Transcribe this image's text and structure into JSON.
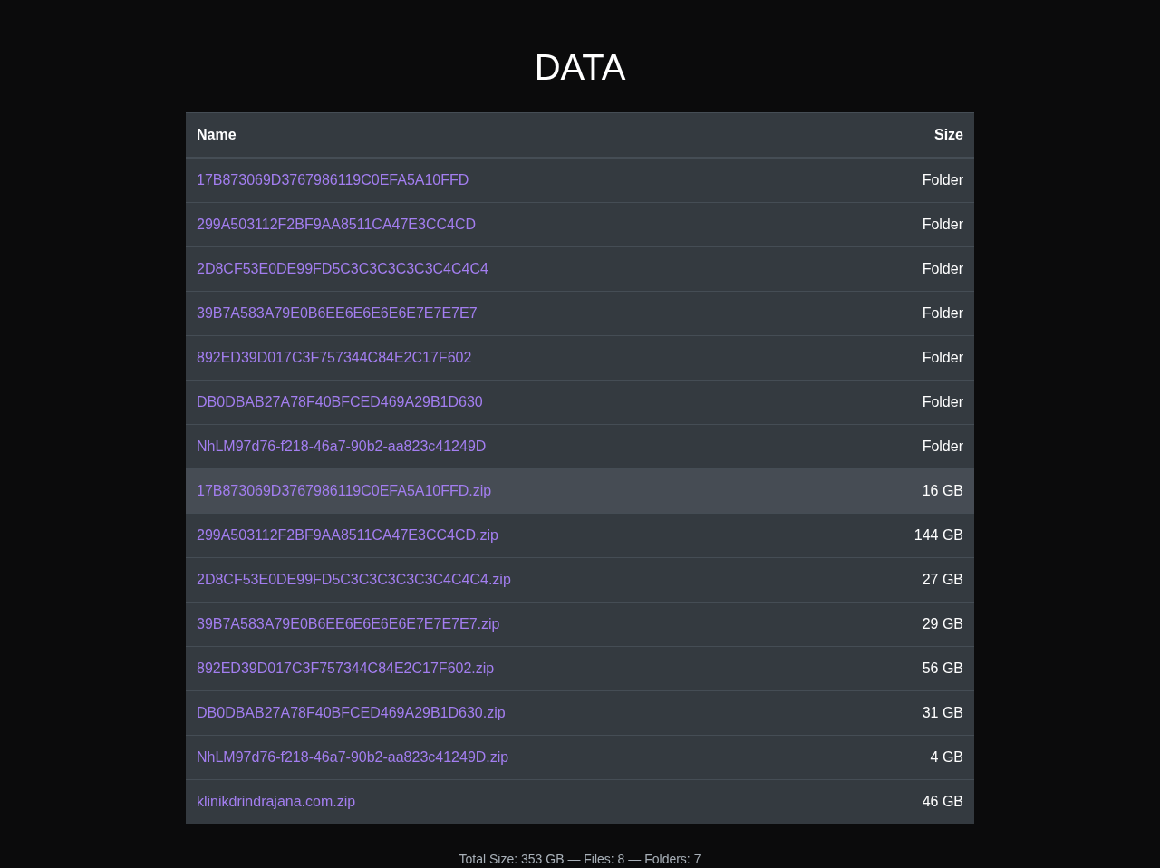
{
  "title": "DATA",
  "table": {
    "columns": [
      "Name",
      "Size"
    ],
    "rows": [
      {
        "name": "17B873069D3767986119C0EFA5A10FFD",
        "size": "Folder",
        "highlighted": false
      },
      {
        "name": "299A503112F2BF9AA8511CA47E3CC4CD",
        "size": "Folder",
        "highlighted": false
      },
      {
        "name": "2D8CF53E0DE99FD5C3C3C3C3C3C4C4C4",
        "size": "Folder",
        "highlighted": false
      },
      {
        "name": "39B7A583A79E0B6EE6E6E6E6E7E7E7E7",
        "size": "Folder",
        "highlighted": false
      },
      {
        "name": "892ED39D017C3F757344C84E2C17F602",
        "size": "Folder",
        "highlighted": false
      },
      {
        "name": "DB0DBAB27A78F40BFCED469A29B1D630",
        "size": "Folder",
        "highlighted": false
      },
      {
        "name": "NhLM97d76-f218-46a7-90b2-aa823c41249D",
        "size": "Folder",
        "highlighted": false
      },
      {
        "name": "17B873069D3767986119C0EFA5A10FFD.zip",
        "size": "16 GB",
        "highlighted": true
      },
      {
        "name": "299A503112F2BF9AA8511CA47E3CC4CD.zip",
        "size": "144 GB",
        "highlighted": false
      },
      {
        "name": "2D8CF53E0DE99FD5C3C3C3C3C3C4C4C4.zip",
        "size": "27 GB",
        "highlighted": false
      },
      {
        "name": "39B7A583A79E0B6EE6E6E6E6E7E7E7E7.zip",
        "size": "29 GB",
        "highlighted": false
      },
      {
        "name": "892ED39D017C3F757344C84E2C17F602.zip",
        "size": "56 GB",
        "highlighted": false
      },
      {
        "name": "DB0DBAB27A78F40BFCED469A29B1D630.zip",
        "size": "31 GB",
        "highlighted": false
      },
      {
        "name": "NhLM97d76-f218-46a7-90b2-aa823c41249D.zip",
        "size": "4 GB",
        "highlighted": false
      },
      {
        "name": "klinikdrindrajana.com.zip",
        "size": "46 GB",
        "highlighted": false
      }
    ]
  },
  "footer": "Total Size: 353 GB — Files: 8 — Folders: 7"
}
